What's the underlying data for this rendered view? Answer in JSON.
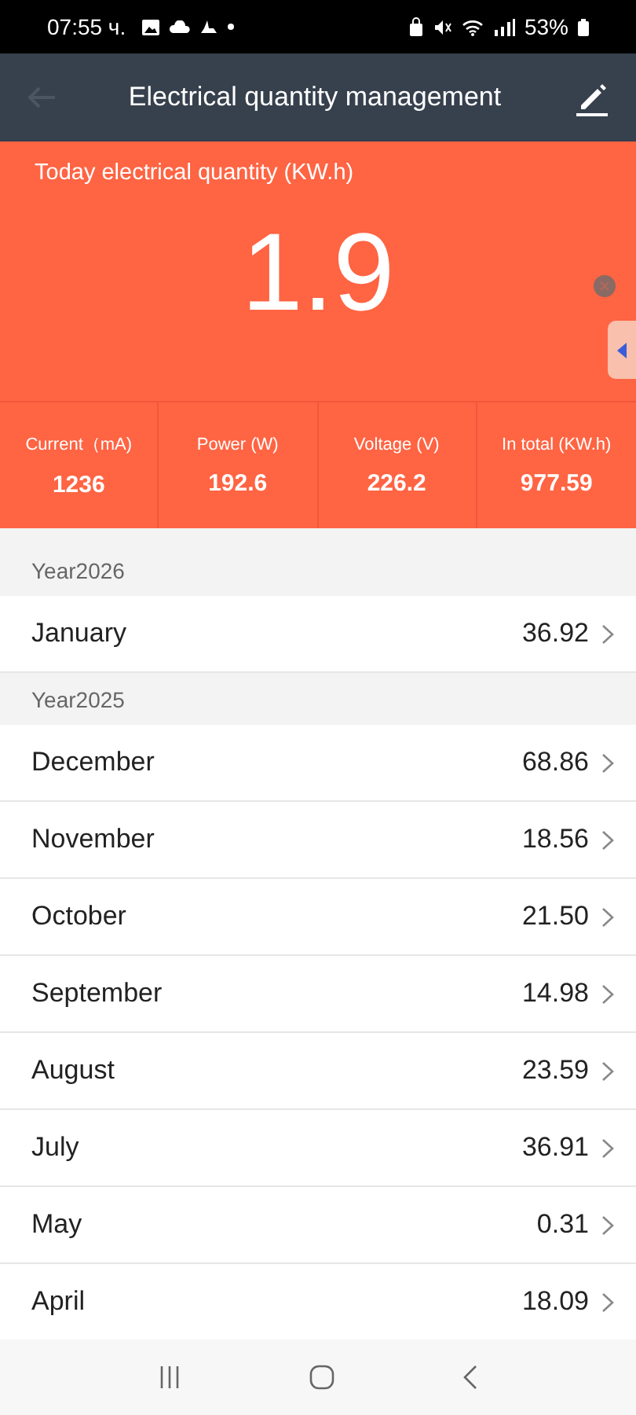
{
  "status_bar": {
    "time": "07:55 ч.",
    "battery": "53%"
  },
  "app_bar": {
    "title": "Electrical quantity management"
  },
  "today": {
    "label": "Today electrical quantity (KW.h)",
    "value": "1.9"
  },
  "stats": [
    {
      "label": "Current（mA)",
      "value": "1236"
    },
    {
      "label": "Power (W)",
      "value": "192.6"
    },
    {
      "label": "Voltage (V)",
      "value": "226.2"
    },
    {
      "label": "In total (KW.h)",
      "value": "977.59"
    }
  ],
  "years": [
    {
      "title": "Year2026",
      "months": [
        {
          "name": "January",
          "value": "36.92"
        }
      ]
    },
    {
      "title": "Year2025",
      "months": [
        {
          "name": "December",
          "value": "68.86"
        },
        {
          "name": "November",
          "value": "18.56"
        },
        {
          "name": "October",
          "value": "21.50"
        },
        {
          "name": "September",
          "value": "14.98"
        },
        {
          "name": "August",
          "value": "23.59"
        },
        {
          "name": "July",
          "value": "36.91"
        },
        {
          "name": "May",
          "value": "0.31"
        },
        {
          "name": "April",
          "value": "18.09"
        }
      ]
    }
  ]
}
